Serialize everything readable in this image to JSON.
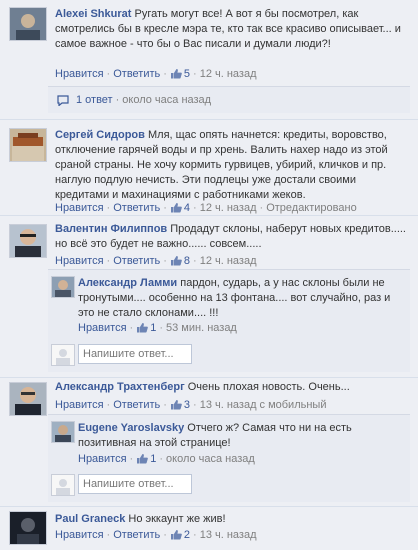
{
  "labels": {
    "like": "Нравится",
    "reply": "Ответить",
    "dot": "·",
    "reply_placeholder": "Напишите ответ..."
  },
  "colors": {
    "link": "#3b5998",
    "background": "#edeff4",
    "reply_background": "#e8ebf2"
  },
  "comments": [
    {
      "author": "Alexei Shkurat",
      "text": "Ругать могут все! А вот я бы посмотрел, как смотрелись бы в кресле мэра те, кто так все красиво описывает... и самое важное - что бы о Вас писали и думали люди?!",
      "likes": "5",
      "time": "12 ч. назад",
      "replies_summary": {
        "count_label": "1 ответ",
        "time": "около часа назад"
      }
    },
    {
      "author": "Сергей Сидоров",
      "text": "Мля, щас опять начнется: кредиты, воровство, отключение гарячей воды и пр хрень. Валить нахер надо из этой сраной страны. Не хочу кормить гурвицев, убирий, кличков и пр. наглую подлую нечисть. Эти подлецы уже достали своими кредитами и махинациями с работниками жеков.",
      "likes": "4",
      "time": "12 ч. назад",
      "extra": "Отредактировано"
    },
    {
      "author": "Валентин Филиппов",
      "text": "Продадут склоны, наберут новых кредитов..... но всё это будет не важно...... совсем.....",
      "likes": "8",
      "time": "12 ч. назад",
      "reply": {
        "author": "Александр Ламми",
        "text": "пардон, сударь, а у нас склоны были не тронутыми.... особенно на 13 фонтана.... вот случайно, раз и это не стало склонами.... !!!",
        "likes": "1",
        "time": "53 мин. назад"
      }
    },
    {
      "author": "Александр Трахтенберг",
      "text": "Очень плохая новость. Очень...",
      "likes": "3",
      "time": "13 ч. назад",
      "extra": "с мобильный",
      "reply": {
        "author": "Eugene Yaroslavsky",
        "text": "Отчего ж? Самая что ни на есть позитивная на этой странице!",
        "likes": "1",
        "time": "около часа назад"
      }
    },
    {
      "author": "Paul Graneck",
      "text": "Но эккаунт же жив!",
      "likes": "2",
      "time": "13 ч. назад"
    }
  ]
}
